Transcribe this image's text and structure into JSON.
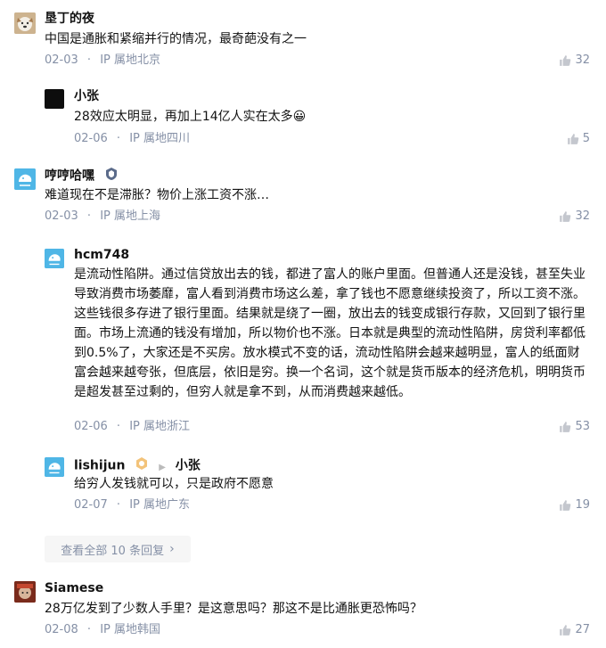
{
  "comments": [
    {
      "name": "垦丁的夜",
      "text": "中国是通胀和紧缩并行的情况，最奇葩没有之一",
      "date": "02-03",
      "location": "IP 属地北京",
      "likes": "32"
    },
    {
      "name": "小张",
      "text": "28效应太明显，再加上14亿人实在太多😀",
      "date": "02-06",
      "location": "IP 属地四川",
      "likes": "5"
    },
    {
      "name": "哼哼哈嘿",
      "text": "难道现在不是滞胀？物价上涨工资不涨…",
      "date": "02-03",
      "location": "IP 属地上海",
      "likes": "32"
    },
    {
      "name": "hcm748",
      "text": "是流动性陷阱。通过信贷放出去的钱，都进了富人的账户里面。但普通人还是没钱，甚至失业导致消费市场萎靡，富人看到消费市场这么差，拿了钱也不愿意继续投资了，所以工资不涨。这些钱很多存进了银行里面。结果就是绕了一圈，放出去的钱变成银行存款，又回到了银行里面。市场上流通的钱没有增加，所以物价也不涨。日本就是典型的流动性陷阱，房贷利率都低到0.5%了，大家还是不买房。放水模式不变的话，流动性陷阱会越来越明显，富人的纸面财富会越来越夸张，但底层，依旧是穷。换一个名词，这个就是货币版本的经济危机，明明货币是超发甚至过剩的，但穷人就是拿不到，从而消费越来越低。",
      "date": "02-06",
      "location": "IP 属地浙江",
      "likes": "53"
    },
    {
      "name": "lishijun",
      "reply_to": "小张",
      "text": "给穷人发钱就可以，只是政府不愿意",
      "date": "02-07",
      "location": "IP 属地广东",
      "likes": "19"
    },
    {
      "name": "Siamese",
      "text": "28万亿发到了少数人手里？是这意思吗？那这不是比通胀更恐怖吗？",
      "date": "02-08",
      "location": "IP 属地韩国",
      "likes": "27"
    }
  ],
  "more_replies": "查看全部 10 条回复",
  "meta_sep": "·",
  "colors": {
    "meta": "#8590a6",
    "text": "#121212",
    "blue_avatar": "#4fb6e6"
  }
}
